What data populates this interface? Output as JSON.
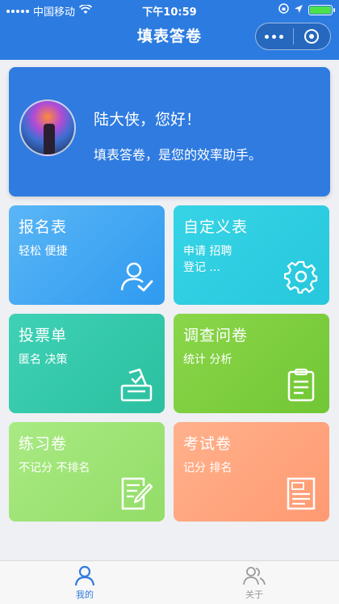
{
  "status_bar": {
    "carrier": "中国移动",
    "time": "下午10:59"
  },
  "nav": {
    "title": "填表答卷"
  },
  "profile": {
    "greeting": "陆大侠，您好！",
    "subtitle": "填表答卷，是您的效率助手。"
  },
  "tiles": [
    {
      "title": "报名表",
      "subtitle": "轻松 便捷",
      "icon": "user-check-icon"
    },
    {
      "title": "自定义表",
      "subtitle": "申请 招聘\n登记 ...",
      "icon": "gear-icon"
    },
    {
      "title": "投票单",
      "subtitle": "匿名 决策",
      "icon": "ballot-box-icon"
    },
    {
      "title": "调查问卷",
      "subtitle": "统计 分析",
      "icon": "clipboard-icon"
    },
    {
      "title": "练习卷",
      "subtitle": "不记分 不排名",
      "icon": "edit-document-icon"
    },
    {
      "title": "考试卷",
      "subtitle": "记分 排名",
      "icon": "score-sheet-icon"
    }
  ],
  "tabbar": {
    "items": [
      {
        "label": "我的",
        "icon": "person-icon",
        "active": true
      },
      {
        "label": "关于",
        "icon": "group-icon",
        "active": false
      }
    ]
  },
  "colors": {
    "primary": "#2f7be0",
    "background": "#eef0f3"
  }
}
